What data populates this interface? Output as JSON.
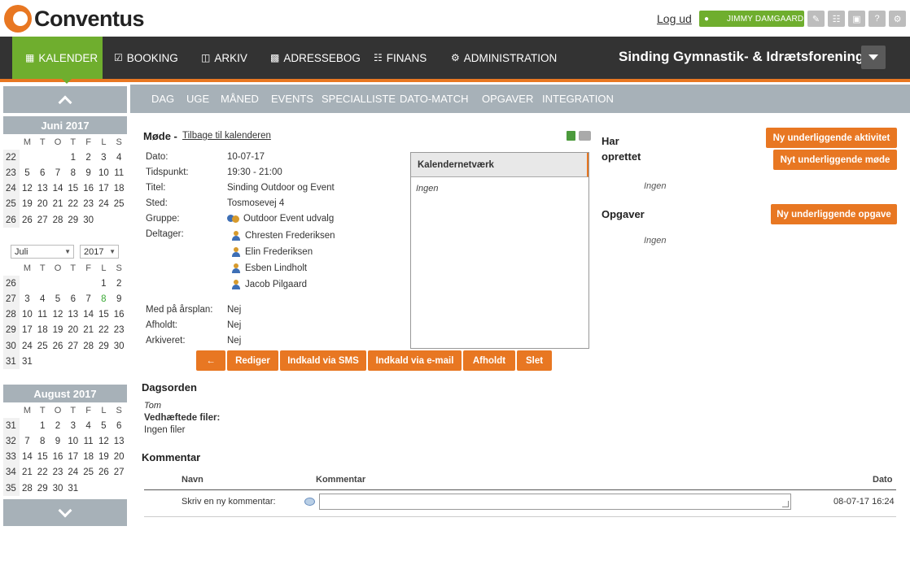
{
  "header": {
    "logo_text": "Conventus",
    "logout": "Log ud",
    "user": "JIMMY DAMGAARD",
    "icons": [
      "chat-icon",
      "bank-icon",
      "monitor-icon",
      "help-icon",
      "gear-icon"
    ]
  },
  "nav": {
    "items": [
      {
        "label": "KALENDER",
        "icon": "calendar-icon",
        "active": true
      },
      {
        "label": "BOOKING",
        "icon": "calendar-check-icon"
      },
      {
        "label": "ARKIV",
        "icon": "folder-icon"
      },
      {
        "label": "ADRESSEBOG",
        "icon": "contact-book-icon"
      },
      {
        "label": "FINANS",
        "icon": "bank-icon"
      },
      {
        "label": "ADMINISTRATION",
        "icon": "gear-icon"
      }
    ],
    "organization": "Sinding Gymnastik- & Idrætsforening"
  },
  "subnav": [
    "DAG",
    "UGE",
    "MÅNED",
    "EVENTS",
    "SPECIALLISTE",
    "DATO-MATCH",
    "OPGAVER",
    "INTEGRATION"
  ],
  "calendar": {
    "weekday_headers": [
      "M",
      "T",
      "O",
      "T",
      "F",
      "L",
      "S"
    ],
    "june": {
      "title": "Juni 2017",
      "rows": [
        {
          "wk": "22",
          "days": [
            "",
            "",
            "",
            "1",
            "2",
            "3",
            "4"
          ]
        },
        {
          "wk": "23",
          "days": [
            "5",
            "6",
            "7",
            "8",
            "9",
            "10",
            "11"
          ]
        },
        {
          "wk": "24",
          "days": [
            "12",
            "13",
            "14",
            "15",
            "16",
            "17",
            "18"
          ]
        },
        {
          "wk": "25",
          "days": [
            "19",
            "20",
            "21",
            "22",
            "23",
            "24",
            "25"
          ]
        },
        {
          "wk": "26",
          "days": [
            "26",
            "27",
            "28",
            "29",
            "30",
            "",
            ""
          ]
        }
      ]
    },
    "july": {
      "month_select": "Juli",
      "year_select": "2017",
      "rows": [
        {
          "wk": "26",
          "days": [
            "",
            "",
            "",
            "",
            "",
            "1",
            "2"
          ]
        },
        {
          "wk": "27",
          "days": [
            "3",
            "4",
            "5",
            "6",
            "7",
            "8",
            "9"
          ]
        },
        {
          "wk": "28",
          "days": [
            "10",
            "11",
            "12",
            "13",
            "14",
            "15",
            "16"
          ]
        },
        {
          "wk": "29",
          "days": [
            "17",
            "18",
            "19",
            "20",
            "21",
            "22",
            "23"
          ]
        },
        {
          "wk": "30",
          "days": [
            "24",
            "25",
            "26",
            "27",
            "28",
            "29",
            "30"
          ]
        },
        {
          "wk": "31",
          "days": [
            "31",
            "",
            "",
            "",
            "",
            "",
            ""
          ]
        }
      ],
      "highlight": "8"
    },
    "august": {
      "title": "August 2017",
      "rows": [
        {
          "wk": "31",
          "days": [
            "",
            "1",
            "2",
            "3",
            "4",
            "5",
            "6"
          ]
        },
        {
          "wk": "32",
          "days": [
            "7",
            "8",
            "9",
            "10",
            "11",
            "12",
            "13"
          ]
        },
        {
          "wk": "33",
          "days": [
            "14",
            "15",
            "16",
            "17",
            "18",
            "19",
            "20"
          ]
        },
        {
          "wk": "34",
          "days": [
            "21",
            "22",
            "23",
            "24",
            "25",
            "26",
            "27"
          ]
        },
        {
          "wk": "35",
          "days": [
            "28",
            "29",
            "30",
            "31",
            "",
            "",
            ""
          ]
        }
      ]
    }
  },
  "meeting": {
    "title": "Møde -",
    "back_link": "Tilbage til kalenderen",
    "fields": [
      {
        "label": "Dato:",
        "value": "10-07-17"
      },
      {
        "label": "Tidspunkt:",
        "value": "19:30 - 21:00"
      },
      {
        "label": "Titel:",
        "value": "Sinding Outdoor og Event"
      },
      {
        "label": "Sted:",
        "value": "Tosmosevej 4"
      },
      {
        "label": "Gruppe:",
        "value": "Outdoor Event udvalg"
      },
      {
        "label": "Deltager:",
        "value": ""
      }
    ],
    "participants": [
      "Chresten Frederiksen",
      "Elin Frederiksen",
      "Esben Lindholt",
      "Jacob Pilgaard"
    ],
    "fields2": [
      {
        "label": "Med på årsplan:",
        "value": "Nej"
      },
      {
        "label": "Afholdt:",
        "value": "Nej"
      },
      {
        "label": "Arkiveret:",
        "value": "Nej"
      }
    ],
    "network_title": "Kalendernetværk",
    "network_value": "Ingen",
    "buttons": [
      "←",
      "Rediger",
      "Indkald via SMS",
      "Indkald via e-mail",
      "Afholdt",
      "Slet"
    ]
  },
  "right": {
    "created_heading_1": "Har",
    "created_heading_2": "oprettet",
    "btn_activity": "Ny underliggende aktivitet",
    "btn_meeting": "Nyt underliggende møde",
    "created_value": "Ingen",
    "tasks_heading": "Opgaver",
    "btn_task": "Ny underliggende opgave",
    "tasks_value": "Ingen"
  },
  "agenda": {
    "heading": "Dagsorden",
    "value": "Tom",
    "files_label": "Vedhæftede filer:",
    "files_value": "Ingen filer"
  },
  "comments": {
    "heading": "Kommentar",
    "col_name": "Navn",
    "col_comment": "Kommentar",
    "col_date": "Dato",
    "new_label": "Skriv en ny kommentar:",
    "date_value": "08-07-17 16:24"
  }
}
